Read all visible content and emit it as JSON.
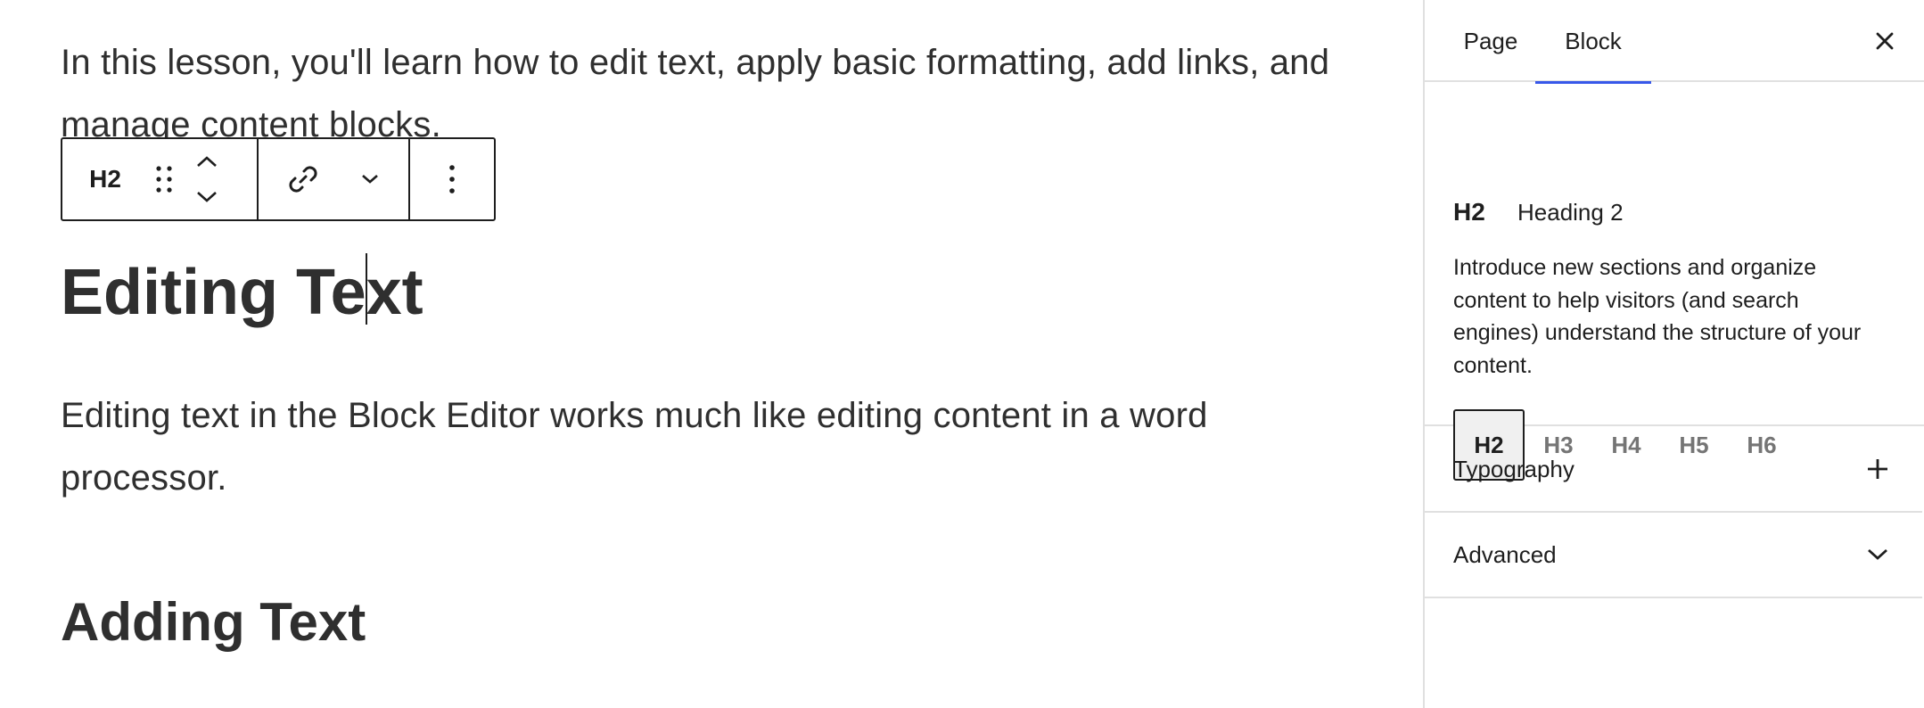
{
  "canvas": {
    "intro_paragraph": "In this lesson, you'll learn how to edit text, apply basic formatting, add links, and manage content blocks.",
    "heading_editing_before_caret": "Editing Te",
    "heading_editing_after_caret": "xt",
    "editing_paragraph": "Editing text in the Block Editor works much like editing content in a word processor.",
    "heading_adding": "Adding Text"
  },
  "block_toolbar": {
    "block_type_label": "H2",
    "icons": {
      "drag": "drag-handle-icon",
      "move_up": "chevron-up-icon",
      "move_down": "chevron-down-icon",
      "link": "link-icon",
      "more_format": "chevron-down-icon",
      "options": "more-vertical-icon"
    }
  },
  "sidebar": {
    "tabs": [
      {
        "label": "Page",
        "active": false
      },
      {
        "label": "Block",
        "active": true
      }
    ],
    "close_icon": "close-icon",
    "block_card": {
      "icon_label": "H2",
      "title": "Heading 2",
      "description": "Introduce new sections and organize content to help visitors (and search engines) understand the structure of your content."
    },
    "heading_levels": [
      {
        "label": "H2",
        "selected": true
      },
      {
        "label": "H3",
        "selected": false
      },
      {
        "label": "H4",
        "selected": false
      },
      {
        "label": "H5",
        "selected": false
      },
      {
        "label": "H6",
        "selected": false
      }
    ],
    "panels": [
      {
        "title": "Typography",
        "icon": "plus-icon"
      },
      {
        "title": "Advanced",
        "icon": "chevron-down-icon"
      }
    ]
  },
  "colors": {
    "accent": "#3858e9",
    "text": "#1e1e1e",
    "muted": "#757575",
    "border": "#e0e0e0"
  }
}
